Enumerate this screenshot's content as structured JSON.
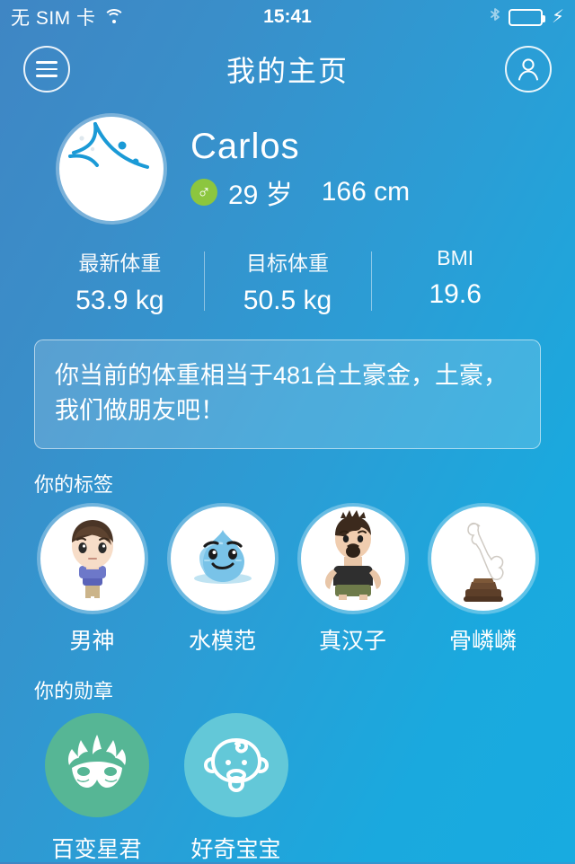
{
  "status_bar": {
    "carrier": "无 SIM 卡",
    "time": "15:41",
    "wifi_icon": "wifi-icon",
    "bluetooth_icon": "bluetooth-icon",
    "battery_icon": "battery-full-icon",
    "charging_icon": "lightning-bolt-icon"
  },
  "navbar": {
    "menu_icon": "hamburger-menu-icon",
    "title": "我的主页",
    "account_icon": "person-account-icon"
  },
  "profile": {
    "avatar_icon": "user-avatar-placeholder-icon",
    "name": "Carlos",
    "gender_symbol": "♂",
    "gender_color": "#8cc63f",
    "age": "29 岁",
    "height": "166 cm"
  },
  "stats": [
    {
      "label": "最新体重",
      "value": "53.9 kg"
    },
    {
      "label": "目标体重",
      "value": "50.5 kg"
    },
    {
      "label": "BMI",
      "value": "19.6"
    }
  ],
  "message_card": {
    "text": "你当前的体重相当于481台土豪金，土豪，我们做朋友吧！"
  },
  "tags_section": {
    "title": "你的标签",
    "items": [
      {
        "label": "男神",
        "icon": "boy-character-icon"
      },
      {
        "label": "水模范",
        "icon": "water-drop-face-icon"
      },
      {
        "label": "真汉子",
        "icon": "muscular-man-icon"
      },
      {
        "label": "骨嶙嶙",
        "icon": "bone-trophy-icon"
      }
    ]
  },
  "badges_section": {
    "title": "你的勋章",
    "items": [
      {
        "label": "百变星君",
        "icon": "carnival-masks-icon",
        "color": "#56b695"
      },
      {
        "label": "好奇宝宝",
        "icon": "baby-face-icon",
        "color": "#63c8d8"
      }
    ]
  },
  "theme": {
    "bg_top_left": "#3f86c4",
    "bg_bottom_right": "#18abe0",
    "battery_green": "#4cd964"
  }
}
